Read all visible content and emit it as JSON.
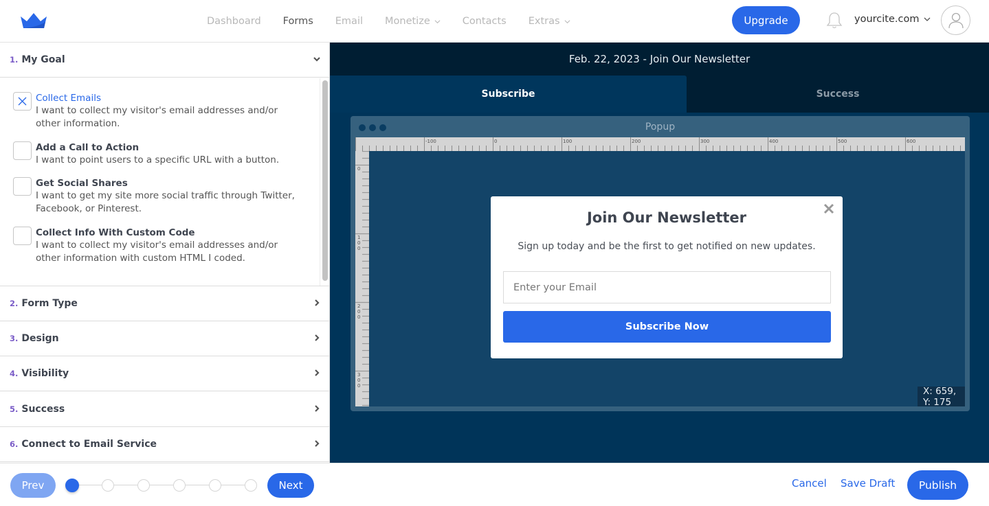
{
  "topbar": {
    "logo": "crown-logo",
    "nav": [
      {
        "label": "Dashboard",
        "active": false,
        "dropdown": false
      },
      {
        "label": "Forms",
        "active": true,
        "dropdown": false
      },
      {
        "label": "Email",
        "active": false,
        "dropdown": false
      },
      {
        "label": "Monetize",
        "active": false,
        "dropdown": true
      },
      {
        "label": "Contacts",
        "active": false,
        "dropdown": false
      },
      {
        "label": "Extras",
        "active": false,
        "dropdown": true
      }
    ],
    "upgrade_label": "Upgrade",
    "site_label": "yourcite.com",
    "icons": {
      "notifications": "bell-icon",
      "account": "user-avatar-icon"
    }
  },
  "sidebar": {
    "sections": [
      {
        "num": "1.",
        "label": "My Goal",
        "expanded": true
      },
      {
        "num": "2.",
        "label": "Form Type",
        "expanded": false
      },
      {
        "num": "3.",
        "label": "Design",
        "expanded": false
      },
      {
        "num": "4.",
        "label": "Visibility",
        "expanded": false
      },
      {
        "num": "5.",
        "label": "Success",
        "expanded": false
      },
      {
        "num": "6.",
        "label": "Connect to Email Service",
        "expanded": false
      }
    ],
    "goals": [
      {
        "title": "Collect Emails",
        "desc": "I want to collect my visitor's email addresses and/or other information.",
        "selected": true
      },
      {
        "title": "Add a Call to Action",
        "desc": "I want to point users to a specific URL with a button.",
        "selected": false
      },
      {
        "title": "Get Social Shares",
        "desc": "I want to get my site more social traffic through Twitter, Facebook, or Pinterest.",
        "selected": false
      },
      {
        "title": "Collect Info With Custom Code",
        "desc": "I want to collect my visitor's email addresses and/or other information with custom HTML I coded.",
        "selected": false
      }
    ]
  },
  "canvas": {
    "title": "Feb. 22, 2023 - Join Our Newsletter",
    "tabs": [
      {
        "label": "Subscribe",
        "active": true
      },
      {
        "label": "Success",
        "active": false
      }
    ],
    "window_title": "Popup",
    "ruler_top_labels": [
      "-100",
      "0",
      "100",
      "200",
      "300",
      "400",
      "500",
      "600"
    ],
    "ruler_left_labels": [
      "0",
      "100",
      "200",
      "300"
    ],
    "coordinates": "X: 659, Y: 175",
    "popup": {
      "title": "Join Our Newsletter",
      "subtitle": "Sign up today and be the first to get notified on new updates.",
      "email_placeholder": "Enter your Email",
      "button_label": "Subscribe Now"
    }
  },
  "footer": {
    "prev_label": "Prev",
    "next_label": "Next",
    "steps_total": 6,
    "current_step": 1,
    "cancel_label": "Cancel",
    "save_draft_label": "Save Draft",
    "publish_label": "Publish"
  },
  "colors": {
    "accent": "#2968e8",
    "accent_light": "#7fa6f2",
    "step_number": "#7a5cc7",
    "canvas_bg": "#003459",
    "canvas_header": "#001e33"
  }
}
